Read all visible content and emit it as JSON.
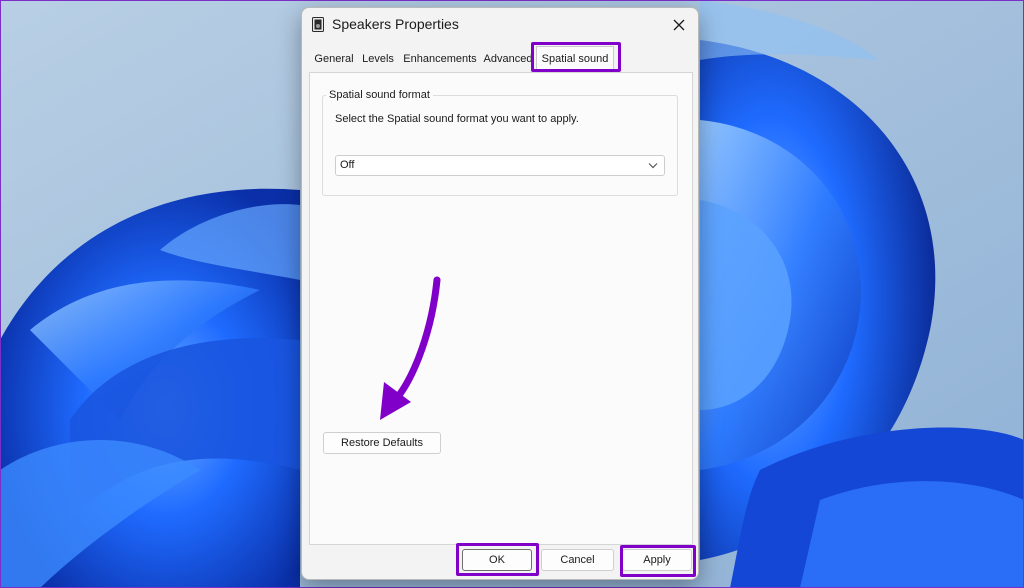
{
  "dialog": {
    "title": "Speakers Properties",
    "tabs": [
      "General",
      "Levels",
      "Enhancements",
      "Advanced",
      "Spatial sound"
    ],
    "active_tab": "Spatial sound"
  },
  "spatial_sound": {
    "group_label": "Spatial sound format",
    "description": "Select the Spatial sound format you want to apply.",
    "format_value": "Off"
  },
  "buttons": {
    "restore_defaults": "Restore Defaults",
    "ok": "OK",
    "cancel": "Cancel",
    "apply": "Apply"
  },
  "colors": {
    "highlight": "#8000c9",
    "wallpaper_accent": "#1f6bff",
    "wallpaper_background": "#a9c3dc"
  },
  "icons": [
    "speaker-icon",
    "close-icon",
    "chevron-down-icon",
    "annotation-arrow"
  ]
}
